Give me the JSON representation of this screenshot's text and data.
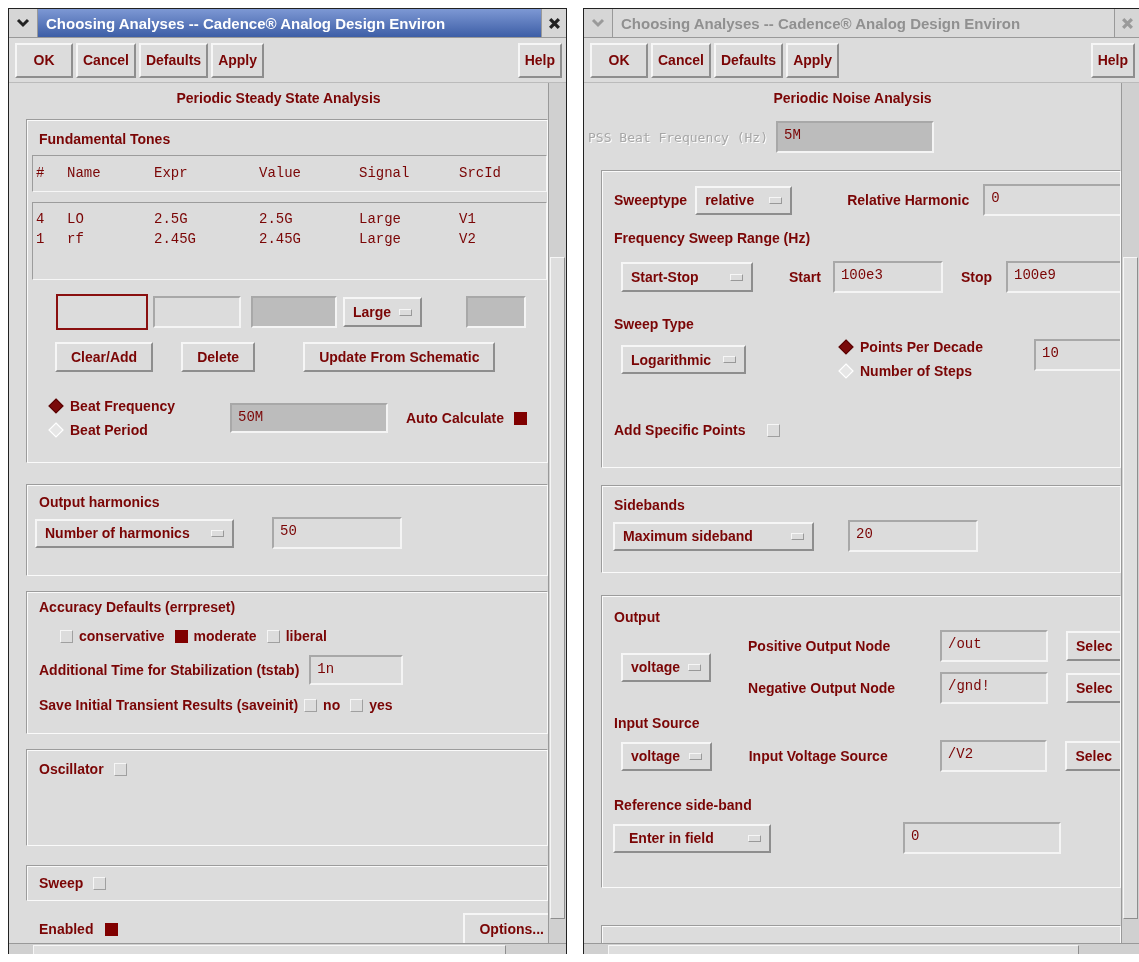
{
  "windows": [
    {
      "kind": "pss",
      "title": "Choosing Analyses -- Cadence® Analog Design Environ",
      "active": true,
      "buttons": [
        "OK",
        "Cancel",
        "Defaults",
        "Apply"
      ],
      "help": "Help",
      "heading": "Periodic Steady State Analysis",
      "tones": {
        "title": "Fundamental Tones",
        "columns": [
          "#",
          "Name",
          "Expr",
          "Value",
          "Signal",
          "SrcId"
        ],
        "rows": [
          [
            "4",
            "LO",
            "2.5G",
            "2.5G",
            "Large",
            "V1"
          ],
          [
            "1",
            "rf",
            "2.45G",
            "2.45G",
            "Large",
            "V2"
          ]
        ],
        "signal": "Large",
        "buttons": [
          "Clear/Add",
          "Delete",
          "Update From Schematic"
        ],
        "beat_options": [
          {
            "label": "Beat Frequency",
            "selected": true
          },
          {
            "label": "Beat Period",
            "selected": false
          }
        ],
        "beat_value": "50M",
        "auto": {
          "label": "Auto Calculate",
          "checked": true
        }
      },
      "harmonics": {
        "title": "Output harmonics",
        "mode": "Number of harmonics",
        "value": "50"
      },
      "accuracy": {
        "title": "Accuracy Defaults (errpreset)",
        "options": [
          {
            "label": "conservative",
            "checked": false
          },
          {
            "label": "moderate",
            "checked": true
          },
          {
            "label": "liberal",
            "checked": false
          }
        ],
        "tstab_label": "Additional Time for Stabilization (tstab)",
        "tstab": "1n",
        "saveinit_label": "Save Initial Transient Results (saveinit)",
        "saveinit": [
          {
            "label": "no",
            "checked": false
          },
          {
            "label": "yes",
            "checked": false
          }
        ]
      },
      "oscillator": {
        "label": "Oscillator",
        "checked": false
      },
      "sweep": {
        "label": "Sweep",
        "checked": false
      },
      "enabled": {
        "label": "Enabled",
        "checked": true
      },
      "options_button": "Options..."
    },
    {
      "kind": "pnoise",
      "title": "Choosing Analyses -- Cadence® Analog Design Environ",
      "active": false,
      "buttons": [
        "OK",
        "Cancel",
        "Defaults",
        "Apply"
      ],
      "help": "Help",
      "heading": "Periodic Noise Analysis",
      "pss_beat": {
        "label": "PSS Beat Frequency (Hz)",
        "value": "5M",
        "disabled": true
      },
      "sweep": {
        "sweeptype_label": "Sweeptype",
        "sweeptype": "relative",
        "harmonic_label": "Relative Harmonic",
        "harmonic": "0",
        "range_label": "Frequency Sweep Range (Hz)",
        "range_mode": "Start-Stop",
        "start_label": "Start",
        "start": "100e3",
        "stop_label": "Stop",
        "stop": "100e9",
        "type_label": "Sweep Type",
        "type": "Logarithmic",
        "step_options": [
          {
            "label": "Points Per Decade",
            "selected": true
          },
          {
            "label": "Number of Steps",
            "selected": false
          }
        ],
        "step_value": "10",
        "specific": {
          "label": "Add Specific Points",
          "checked": false
        }
      },
      "sidebands": {
        "title": "Sidebands",
        "mode": "Maximum sideband",
        "value": "20"
      },
      "output": {
        "title": "Output",
        "mode": "voltage",
        "nodes": [
          {
            "label": "Positive Output Node",
            "value": "/out",
            "button": "Selec"
          },
          {
            "label": "Negative Output Node",
            "value": "/gnd!",
            "button": "Selec"
          }
        ],
        "input_title": "Input Source",
        "input_mode": "voltage",
        "input": {
          "label": "Input Voltage Source",
          "value": "/V2",
          "button": "Selec"
        },
        "ref_title": "Reference side-band",
        "ref_mode": "Enter in field",
        "ref_value": "0"
      }
    }
  ]
}
